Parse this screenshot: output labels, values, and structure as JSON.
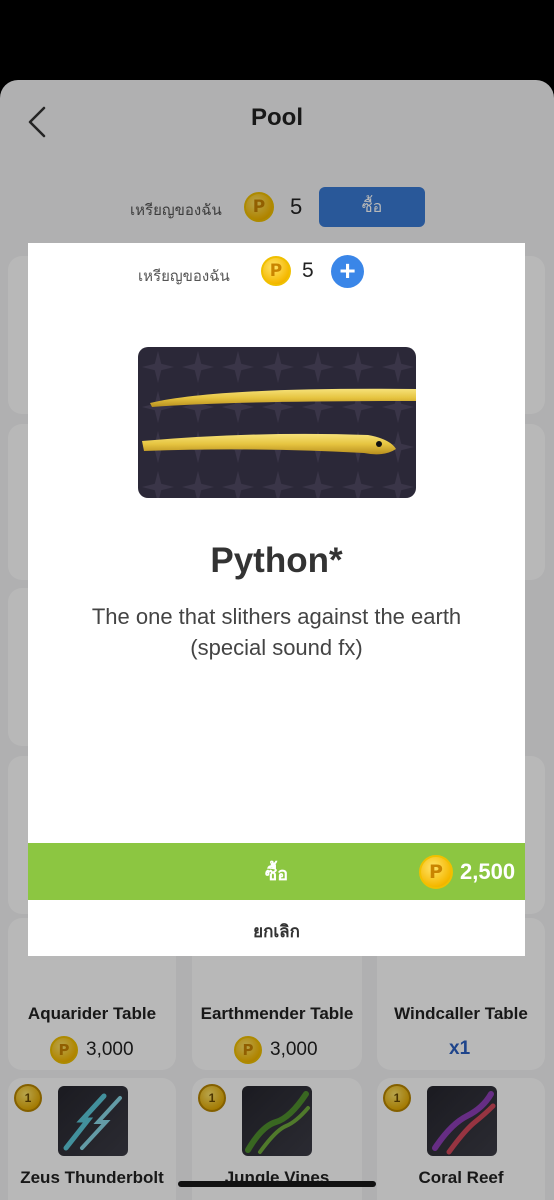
{
  "header": {
    "title": "Pool"
  },
  "balance": {
    "label": "เหรียญของฉัน",
    "count": "5",
    "buy_label": "ซื้อ",
    "coin_glyph": "P"
  },
  "grid": {
    "row1": [
      {
        "name": "Aquarider Table",
        "price": "3,000"
      },
      {
        "name": "Earthmender Table",
        "price": "3,000"
      },
      {
        "name": "Windcaller Table",
        "qty": "x1"
      }
    ],
    "row2": [
      {
        "name": "Zeus Thunderbolt",
        "badge": "1"
      },
      {
        "name": "Jungle Vines",
        "badge": "1"
      },
      {
        "name": "Coral Reef",
        "badge": "1"
      }
    ]
  },
  "modal": {
    "balance_label": "เหรียญของฉัน",
    "balance_count": "5",
    "plus": "+",
    "item_title": "Python*",
    "item_desc": "The one that slithers against the earth (special sound fx)",
    "buy_label": "ซื้อ",
    "price": "2,500",
    "cancel_label": "ยกเลิก"
  },
  "colors": {
    "accent_blue": "#3a7bd5",
    "buy_green": "#8cc641",
    "coin_gold": "#f5b800"
  }
}
